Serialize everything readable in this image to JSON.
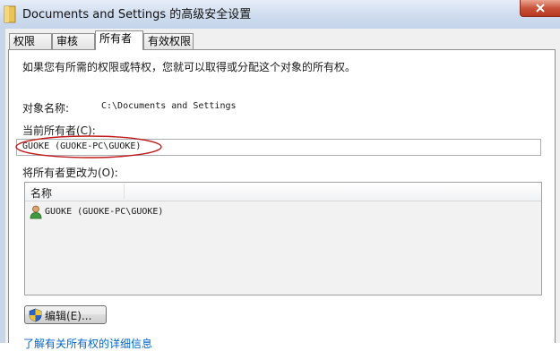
{
  "window": {
    "title": "Documents and Settings 的高级安全设置"
  },
  "tabs": [
    {
      "label": "权限"
    },
    {
      "label": "审核"
    },
    {
      "label": "所有者"
    },
    {
      "label": "有效权限"
    }
  ],
  "active_tab": "所有者",
  "owner_page": {
    "description": "如果您有所需的权限或特权，您就可以取得或分配这个对象的所有权。",
    "object_name_label": "对象名称:",
    "object_name_value": "C:\\Documents and Settings",
    "current_owner_label": "当前所有者(C):",
    "current_owner_value": "GUOKE (GUOKE-PC\\GUOKE)",
    "change_owner_label": "将所有者更改为(O):",
    "list_header": "名称",
    "list_items": [
      {
        "name": "GUOKE (GUOKE-PC\\GUOKE)",
        "icon": "user-icon"
      }
    ],
    "edit_button_label": "编辑(E)...",
    "bottom_link": "了解有关所有权的详细信息"
  },
  "colors": {
    "titlebar": "#cfdcee",
    "close_button": "#c9543b",
    "annotation_ellipse": "#c0191d",
    "link": "#0066cc"
  }
}
